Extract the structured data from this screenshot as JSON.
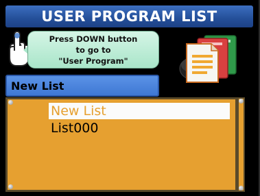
{
  "title": "USER PROGRAM LIST",
  "hint": {
    "line1": "Press DOWN button",
    "line2": "to go to",
    "line3": "\"User Program\""
  },
  "name_field": {
    "value": "New List"
  },
  "list": {
    "items": [
      "New List",
      "List000"
    ],
    "selected_index": 0
  },
  "icons": {
    "hint": "pointing-hand-icon",
    "header": "documents-icon"
  },
  "colors": {
    "title_bar": "#244f99",
    "bubble": "#b7ead2",
    "name_field": "#4a84dc",
    "list_background": "#e6a030",
    "selected_row": "#fbfbfb",
    "selected_text": "#e6a030"
  }
}
